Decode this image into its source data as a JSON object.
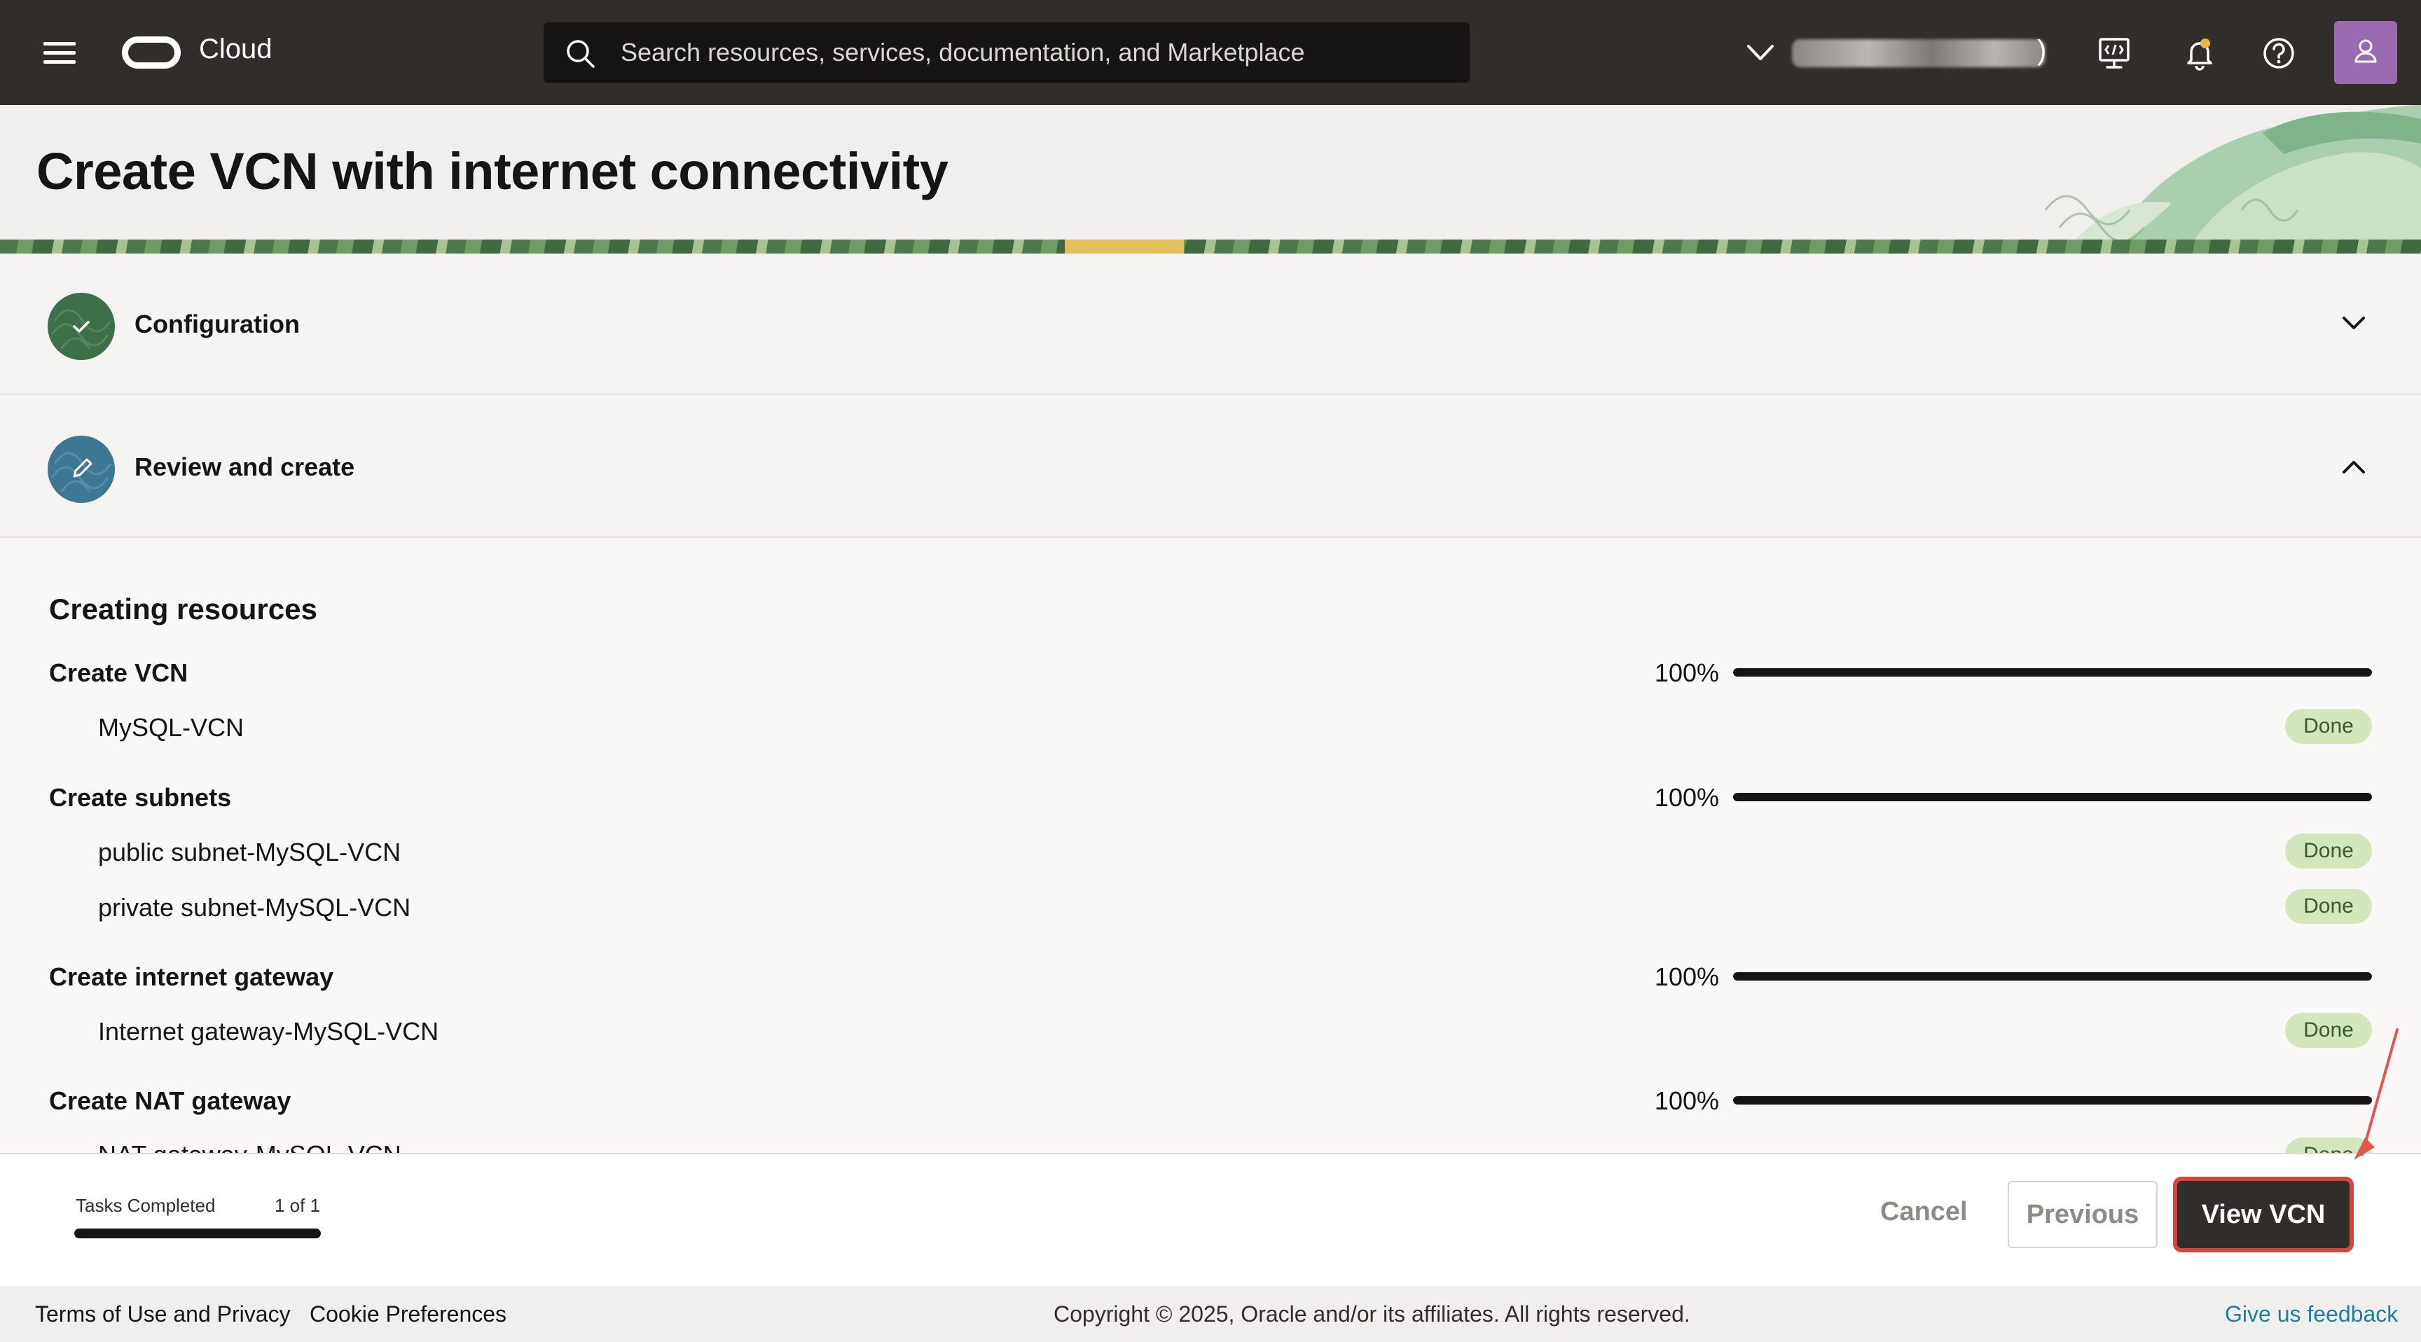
{
  "topbar": {
    "brand": "Cloud",
    "search_placeholder": "Search resources, services, documentation, and Marketplace",
    "region_paren": ")",
    "icons": [
      "hamburger-menu-icon",
      "oracle-logo",
      "search-icon",
      "chevron-down-icon",
      "cloud-shell-icon",
      "bell-icon",
      "help-icon",
      "user-icon"
    ]
  },
  "page": {
    "title": "Create VCN with internet connectivity"
  },
  "sections": [
    {
      "label": "Configuration",
      "state": "completed",
      "icon": "check-icon",
      "expanded": false
    },
    {
      "label": "Review and create",
      "state": "current",
      "icon": "pencil-icon",
      "expanded": true
    }
  ],
  "content": {
    "title": "Creating resources",
    "tasks": [
      {
        "label": "Create VCN",
        "percent_text": "100%",
        "progress": 1.0,
        "items": [
          {
            "label": "MySQL-VCN",
            "status": "Done"
          }
        ]
      },
      {
        "label": "Create subnets",
        "percent_text": "100%",
        "progress": 1.0,
        "items": [
          {
            "label": "public subnet-MySQL-VCN",
            "status": "Done"
          },
          {
            "label": "private subnet-MySQL-VCN",
            "status": "Done"
          }
        ]
      },
      {
        "label": "Create internet gateway",
        "percent_text": "100%",
        "progress": 1.0,
        "items": [
          {
            "label": "Internet gateway-MySQL-VCN",
            "status": "Done"
          }
        ]
      },
      {
        "label": "Create NAT gateway",
        "percent_text": "100%",
        "progress": 1.0,
        "items": [
          {
            "label": "NAT gateway-MySQL-VCN",
            "status": "Done"
          }
        ]
      }
    ]
  },
  "footbar": {
    "tasks_label": "Tasks Completed",
    "tasks_count": "1 of 1",
    "tasks_progress": 1.0,
    "cancel": "Cancel",
    "previous": "Previous",
    "view": "View VCN"
  },
  "footer": {
    "terms": "Terms of Use and Privacy",
    "cookies": "Cookie Preferences",
    "copyright": "Copyright © 2025, Oracle and/or its affiliates. All rights reserved.",
    "feedback": "Give us feedback"
  },
  "colors": {
    "topbar": "#312d2a",
    "primary_button": "#312d2a",
    "highlight": "#d9453d",
    "done_badge": "#d4e7bc",
    "link": "#227e9e"
  }
}
